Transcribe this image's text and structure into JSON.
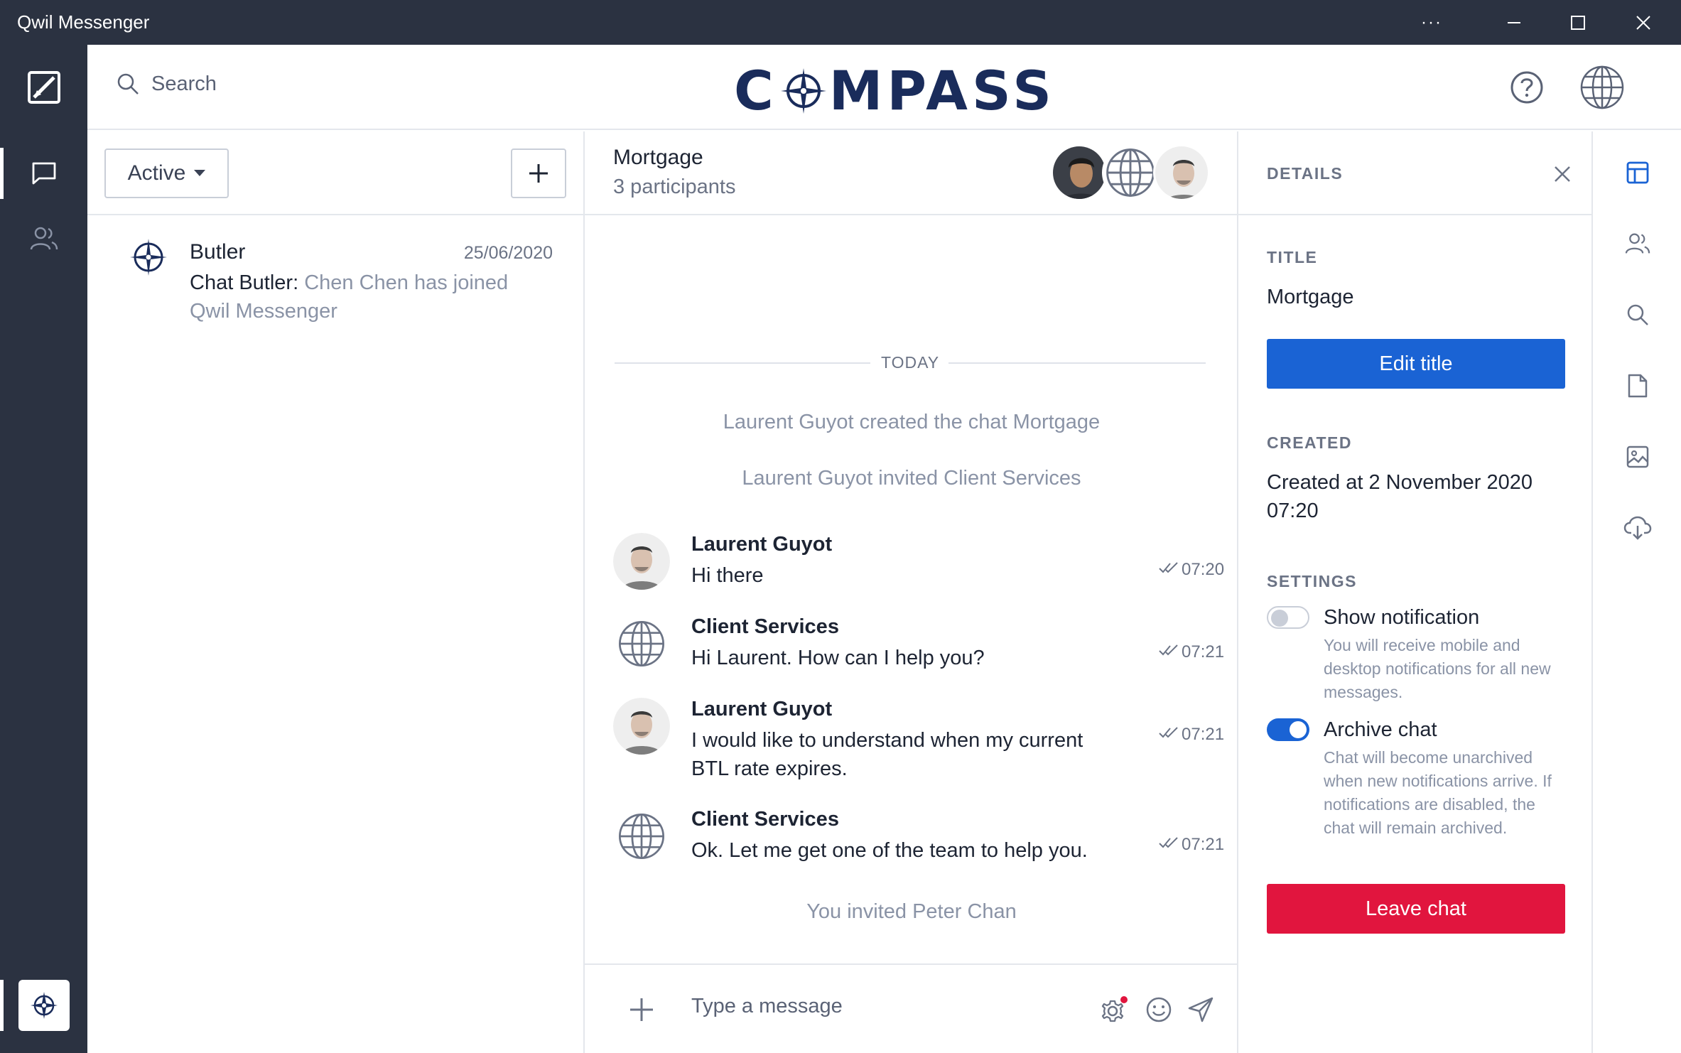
{
  "window": {
    "title": "Qwil Messenger",
    "more_label": "···",
    "minimize_icon": "minimize-icon",
    "maximize_icon": "maximize-icon",
    "close_icon": "close-icon"
  },
  "header": {
    "search_placeholder": "Search",
    "logo_text_before": "C",
    "logo_text_after": "MPASS",
    "help_icon": "help-icon",
    "globe_icon": "globe-icon"
  },
  "chat_list": {
    "filter_label": "Active",
    "conversations": [
      {
        "name": "Butler",
        "date": "25/06/2020",
        "preview_sender": "Chat Butler:",
        "preview_text": "Chen Chen has joined Qwil Messenger"
      }
    ]
  },
  "chat": {
    "title": "Mortgage",
    "subtitle": "3 participants",
    "day_label": "TODAY",
    "system_messages": [
      "Laurent Guyot created the chat Mortgage",
      "Laurent Guyot invited Client Services"
    ],
    "messages": [
      {
        "sender": "Laurent Guyot",
        "text": "Hi there",
        "time": "07:20"
      },
      {
        "sender": "Client Services",
        "text": "Hi Laurent.  How can I help you?",
        "time": "07:21"
      },
      {
        "sender": "Laurent Guyot",
        "text": "I would like to understand when my current BTL rate expires.",
        "time": "07:21"
      },
      {
        "sender": "Client Services",
        "text": "Ok. Let me get one of the team to help you.",
        "time": "07:21"
      }
    ],
    "footer_system": "You invited Peter Chan",
    "composer_placeholder": "Type a message"
  },
  "details": {
    "heading": "DETAILS",
    "title_label": "TITLE",
    "title_value": "Mortgage",
    "edit_button": "Edit title",
    "created_label": "CREATED",
    "created_value": "Created at 2 November 2020 07:20",
    "settings_label": "SETTINGS",
    "settings": [
      {
        "title": "Show notification",
        "description": "You will receive mobile and desktop notifications for all new messages.",
        "enabled": false
      },
      {
        "title": "Archive chat",
        "description": "Chat will become unarchived when new notifications arrive. If notifications are disabled, the chat will remain archived.",
        "enabled": true
      }
    ],
    "leave_button": "Leave chat"
  },
  "colors": {
    "rail": "#2b3241",
    "primary": "#1a63d4",
    "danger": "#e1153e",
    "logo": "#1a2c5b"
  }
}
